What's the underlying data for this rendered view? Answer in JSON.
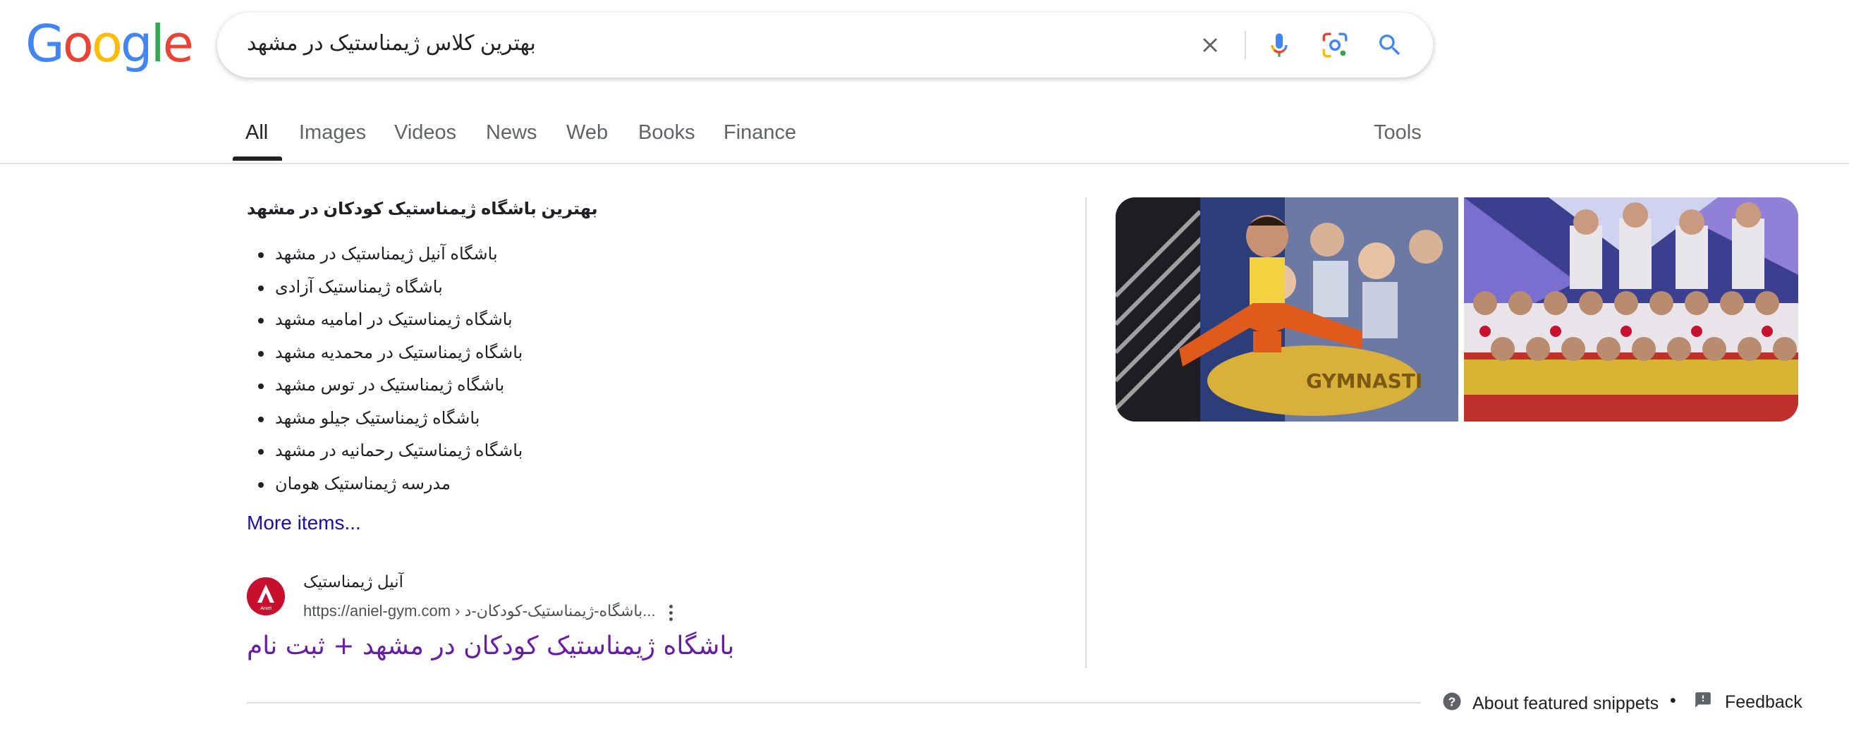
{
  "logo": {
    "letters": [
      "G",
      "o",
      "o",
      "g",
      "l",
      "e"
    ],
    "colors": [
      "#4285F4",
      "#EA4335",
      "#FBBC05",
      "#4285F4",
      "#34A853",
      "#EA4335"
    ]
  },
  "search": {
    "query": "بهترین کلاس ژیمناستیک در مشهد"
  },
  "tabs": [
    {
      "label": "All",
      "active": true
    },
    {
      "label": "Images"
    },
    {
      "label": "Videos"
    },
    {
      "label": "News"
    },
    {
      "label": "Web"
    },
    {
      "label": "Books"
    },
    {
      "label": "Finance"
    }
  ],
  "tools_label": "Tools",
  "snippet": {
    "title": "بهترین باشگاه ژیمناستیک کودکان در مشهد",
    "items": [
      "باشگاه آنیل ژیمناستیک در مشهد",
      "باشگاه ژیمناستیک آزادی",
      "باشگاه ژیمناستیک در امامیه مشهد",
      "باشگاه ژیمناستیک در محمدیه مشهد",
      "باشگاه ژیمناستیک در توس مشهد",
      "باشگاه ژیمناستیک جیلو مشهد",
      "باشگاه ژیمناستیک رحمانیه در مشهد",
      "مدرسه ژیمناستیک هومان"
    ],
    "more_items": "More items..."
  },
  "source": {
    "site_name": "آنیل ژیمناستیک",
    "url": "https://aniel-gym.com › باشگاه-ژیمناستیک-کودکان-د...",
    "favicon_text": "Aniel",
    "result_title": "باشگاه ژیمناستیک کودکان در مشهد + ثبت نام"
  },
  "images": {
    "img1_text": "GYMNASTI"
  },
  "footer": {
    "about": "About featured snippets",
    "separator": "•",
    "feedback": "Feedback"
  },
  "colors": {
    "link_blue": "#1a0dab",
    "visited_purple": "#681da8",
    "google_blue": "#4285F4"
  }
}
